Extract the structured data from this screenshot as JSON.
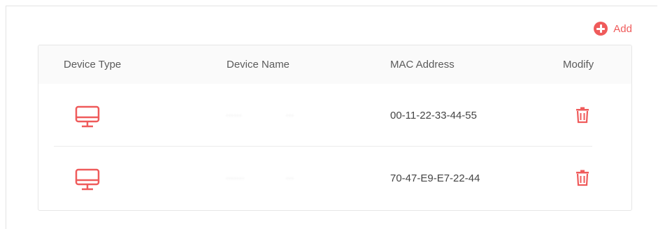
{
  "header": {
    "add_label": "Add"
  },
  "table": {
    "columns": [
      "Device Type",
      "Device Name",
      "MAC Address",
      "Modify"
    ],
    "rows": [
      {
        "device_type_icon": "desktop-monitor-icon",
        "device_name": [
          "······",
          "···"
        ],
        "mac_address": "00-11-22-33-44-55",
        "modify_icon": "trash-icon"
      },
      {
        "device_type_icon": "desktop-monitor-icon",
        "device_name": [
          "·······",
          "···"
        ],
        "mac_address": "70-47-E9-E7-22-44",
        "modify_icon": "trash-icon"
      }
    ]
  },
  "colors": {
    "accent": "#ef5b5b",
    "header_bg": "#fafafa",
    "border": "#e6e6e6",
    "text": "#444444"
  }
}
